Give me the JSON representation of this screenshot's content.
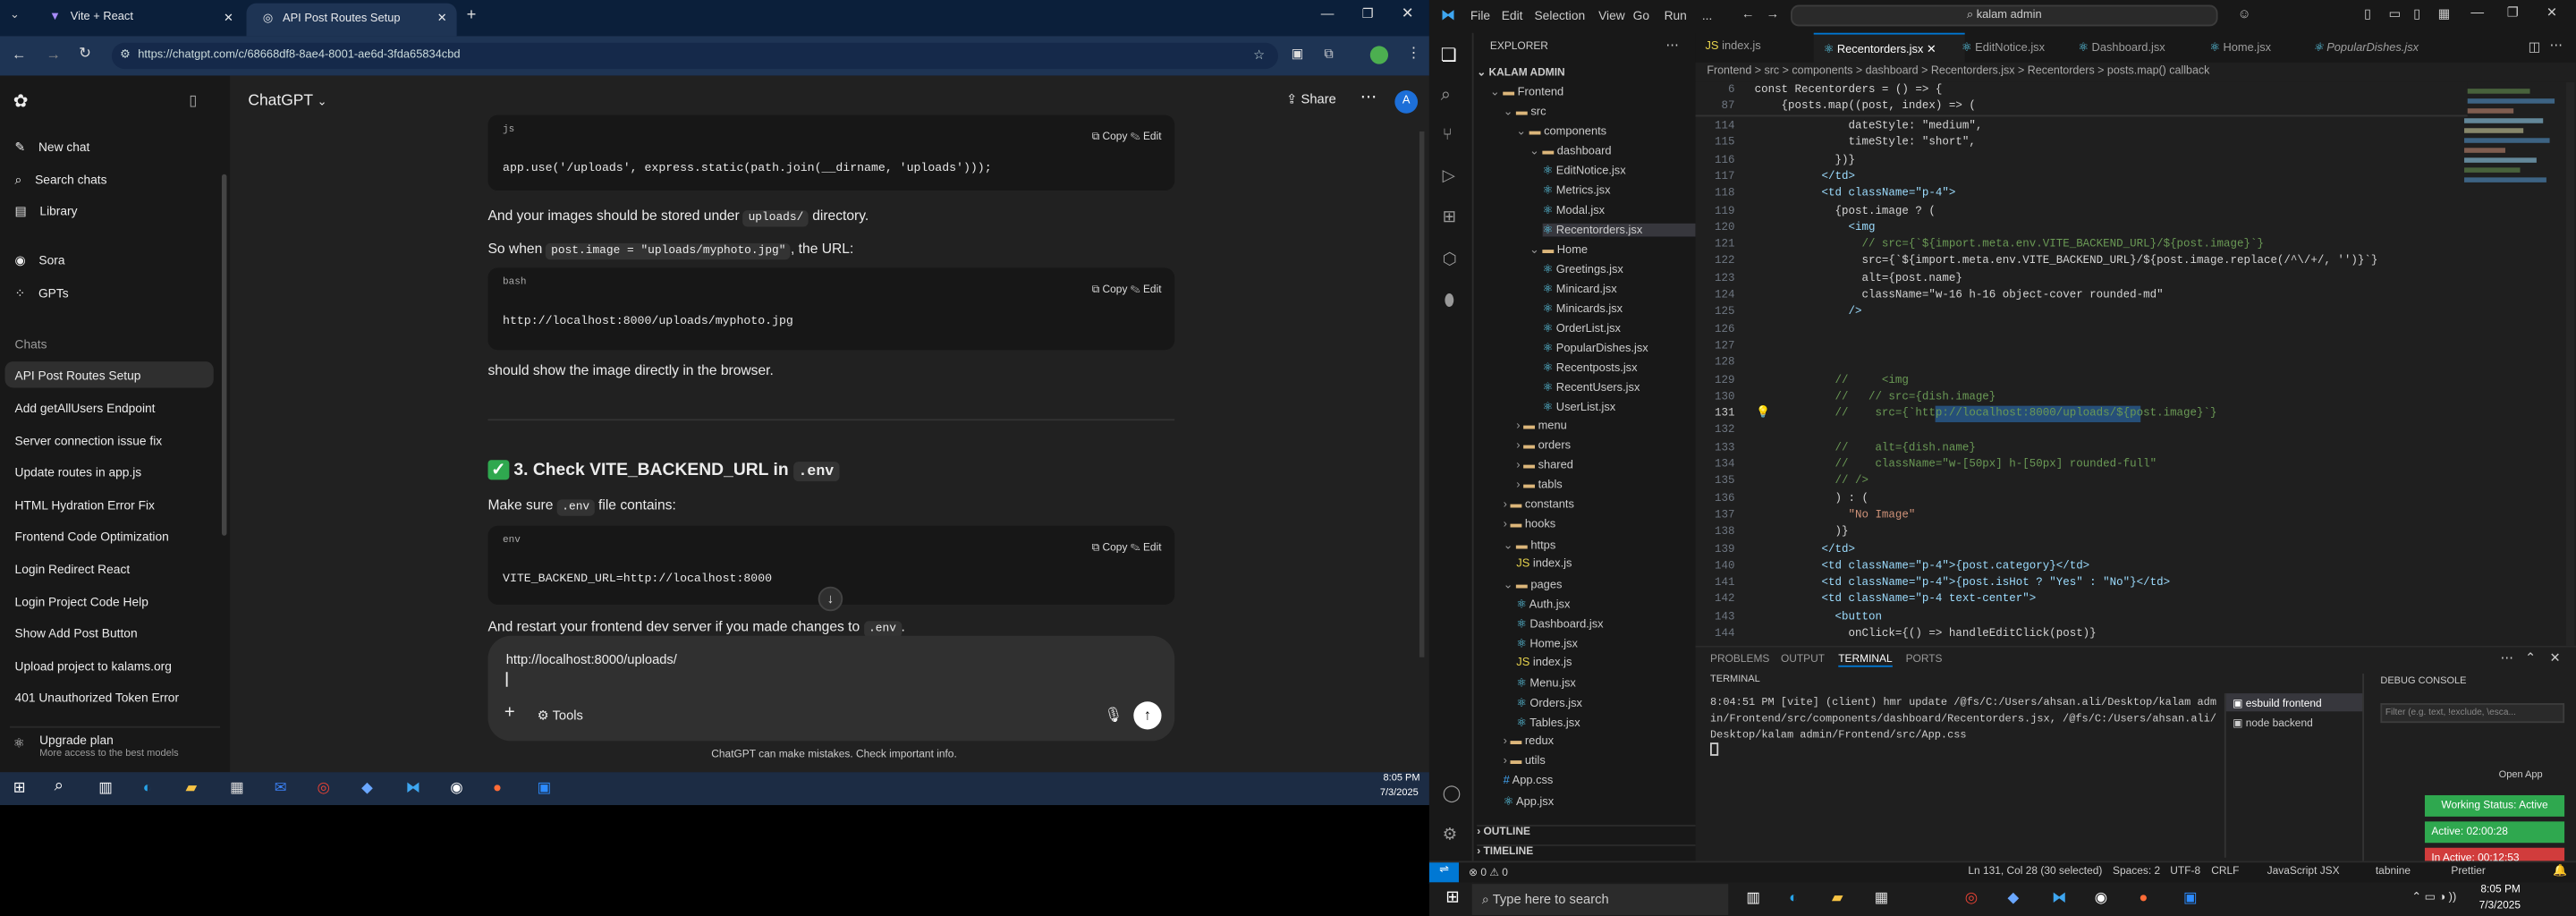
{
  "browser": {
    "tabs": [
      {
        "label": "Vite + React"
      },
      {
        "label": "API Post Routes Setup"
      }
    ],
    "url": "https://chatgpt.com/c/68668df8-8ae4-8001-ae6d-3fda65834cbd"
  },
  "chatgpt": {
    "sidebar": {
      "top_items": [
        "New chat",
        "Search chats",
        "Library"
      ],
      "gpt_items": [
        "Sora",
        "GPTs"
      ],
      "section_title": "Chats",
      "chats": [
        "API Post Routes Setup",
        "Add getAllUsers Endpoint",
        "Server connection issue fix",
        "Update routes in app.js",
        "HTML Hydration Error Fix",
        "Frontend Code Optimization",
        "Login Redirect React",
        "Login Project Code Help",
        "Show Add Post Button",
        "Upload project to kalams.org",
        "401 Unauthorized Token Error"
      ],
      "upgrade_title": "Upgrade plan",
      "upgrade_sub": "More access to the best models"
    },
    "header": {
      "model": "ChatGPT",
      "share": "Share",
      "avatar": "A"
    },
    "messages": {
      "code1_lang": "js",
      "code1": "app.use('/uploads', express.static(path.join(__dirname, 'uploads')));",
      "p1_prefix": "And your images should be stored under",
      "p1_code": "uploads/",
      "p1_suffix": "directory.",
      "p2_prefix": "So when",
      "p2_code": "post.image = \"uploads/myphoto.jpg\"",
      "p2_suffix": ", the URL:",
      "code2_lang": "bash",
      "code2": "http://localhost:8000/uploads/myphoto.jpg",
      "p3": "should show the image directly in the browser.",
      "h3_prefix": "3. Check VITE_BACKEND_URL in",
      "h3_code": ".env",
      "p4_prefix": "Make sure",
      "p4_code": ".env",
      "p4_suffix": "file contains:",
      "code3_lang": "env",
      "code3": "VITE_BACKEND_URL=http://localhost:8000",
      "p5_prefix": "And restart your frontend dev server if you made changes to",
      "p5_code": ".env",
      "p5_suffix": ".",
      "copy": "Copy",
      "edit": "Edit"
    },
    "composer": {
      "value": "http://localhost:8000/uploads/",
      "tools": "Tools"
    },
    "disclaimer": "ChatGPT can make mistakes. Check important info."
  },
  "taskbar_left": {
    "time": "8:05 PM",
    "date": "7/3/2025"
  },
  "vscode": {
    "menu": [
      "File",
      "Edit",
      "Selection",
      "View",
      "Go",
      "Run",
      "..."
    ],
    "search": "kalam admin",
    "explorer_title": "EXPLORER",
    "workspace": "KALAM ADMIN",
    "tree": [
      "Frontend",
      "src",
      "components",
      "dashboard",
      "EditNotice.jsx",
      "Metrics.jsx",
      "Modal.jsx",
      "Recentorders.jsx",
      "Home",
      "Greetings.jsx",
      "Minicard.jsx",
      "Minicards.jsx",
      "OrderList.jsx",
      "PopularDishes.jsx",
      "Recentposts.jsx",
      "RecentUsers.jsx",
      "UserList.jsx",
      "menu",
      "orders",
      "shared",
      "tabls",
      "constants",
      "hooks",
      "https",
      "index.js",
      "pages",
      "Auth.jsx",
      "Dashboard.jsx",
      "Home.jsx",
      "index.js",
      "Menu.jsx",
      "Orders.jsx",
      "Tables.jsx",
      "redux",
      "utils",
      "App.css",
      "App.jsx"
    ],
    "outline": "OUTLINE",
    "timeline": "TIMELINE",
    "tabs": [
      "index.js",
      "Recentorders.jsx",
      "EditNotice.jsx",
      "Dashboard.jsx",
      "Home.jsx",
      "PopularDishes.jsx"
    ],
    "breadcrumb": "Frontend > src > components > dashboard > Recentorders.jsx > Recentorders > posts.map() callback",
    "sticky_lines": [
      {
        "n": "6",
        "t": "const Recentorders = () => {"
      },
      {
        "n": "87",
        "t": "    {posts.map((post, index) => ("
      }
    ],
    "code_lines": [
      {
        "n": "114",
        "t": "              dateStyle: \"medium\","
      },
      {
        "n": "115",
        "t": "              timeStyle: \"short\","
      },
      {
        "n": "116",
        "t": "            })}"
      },
      {
        "n": "117",
        "t": "          </td>"
      },
      {
        "n": "118",
        "t": "          <td className=\"p-4\">"
      },
      {
        "n": "119",
        "t": "            {post.image ? ("
      },
      {
        "n": "120",
        "t": "              <img"
      },
      {
        "n": "121",
        "t": "                // src={`${import.meta.env.VITE_BACKEND_URL}/${post.image}`}"
      },
      {
        "n": "122",
        "t": "                src={`${import.meta.env.VITE_BACKEND_URL}/${post.image.replace(/^\\/+/, '')}`}"
      },
      {
        "n": "123",
        "t": "                alt={post.name}"
      },
      {
        "n": "124",
        "t": "                className=\"w-16 h-16 object-cover rounded-md\""
      },
      {
        "n": "125",
        "t": "              />"
      },
      {
        "n": "126",
        "t": ""
      },
      {
        "n": "127",
        "t": ""
      },
      {
        "n": "128",
        "t": ""
      },
      {
        "n": "129",
        "t": "            //     <img"
      },
      {
        "n": "130",
        "t": "            //   // src={dish.image}"
      },
      {
        "n": "131",
        "t": "            //    src={`http://localhost:8000/uploads/${post.image}`}"
      },
      {
        "n": "132",
        "t": ""
      },
      {
        "n": "133",
        "t": "            //    alt={dish.name}"
      },
      {
        "n": "134",
        "t": "            //    className=\"w-[50px] h-[50px] rounded-full\""
      },
      {
        "n": "135",
        "t": "            // />"
      },
      {
        "n": "136",
        "t": "            ) : ("
      },
      {
        "n": "137",
        "t": "              \"No Image\""
      },
      {
        "n": "138",
        "t": "            )}"
      },
      {
        "n": "139",
        "t": "          </td>"
      },
      {
        "n": "140",
        "t": "          <td className=\"p-4\">{post.category}</td>"
      },
      {
        "n": "141",
        "t": "          <td className=\"p-4\">{post.isHot ? \"Yes\" : \"No\"}</td>"
      },
      {
        "n": "142",
        "t": "          <td className=\"p-4 text-center\">"
      },
      {
        "n": "143",
        "t": "            <button"
      },
      {
        "n": "144",
        "t": "              onClick={() => handleEditClick(post)}"
      }
    ],
    "panel_tabs": [
      "PROBLEMS",
      "OUTPUT",
      "TERMINAL",
      "PORTS"
    ],
    "terminal_title": "TERMINAL",
    "terminal_lines": [
      "8:04:51 PM [vite] (client) hmr update /@fs/C:/Users/ahsan.ali/Desktop/kalam adm",
      "in/Frontend/src/components/dashboard/Recentorders.jsx, /@fs/C:/Users/ahsan.ali/",
      "Desktop/kalam admin/Frontend/src/App.css"
    ],
    "terminals": [
      "esbuild frontend",
      "node backend"
    ],
    "debug_title": "DEBUG CONSOLE",
    "debug_filter": "Filter (e.g. text, !exclude, \\esca...",
    "open_app": "Open App",
    "working_status": "Working Status: Active",
    "active_time": "Active: 02:00:28",
    "inactive_time": "In Active: 00:12:53",
    "status_left": "⊗ 0 ⚠ 0",
    "status_items": [
      "Ln 131, Col 28 (30 selected)",
      "Spaces: 2",
      "UTF-8",
      "CRLF",
      "JavaScript JSX",
      "tabnine",
      "Prettier"
    ]
  },
  "taskbar_right": {
    "search": "Type here to search",
    "time": "8:05 PM",
    "date": "7/3/2025"
  }
}
